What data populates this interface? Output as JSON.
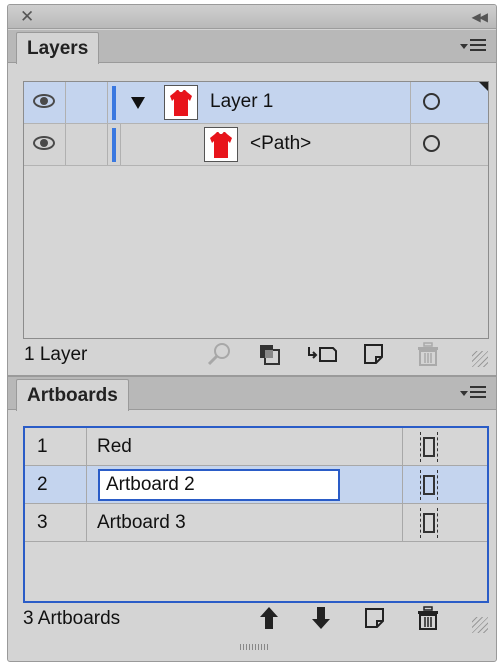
{
  "layers_panel": {
    "tab_label": "Layers",
    "rows": [
      {
        "name": "Layer 1"
      },
      {
        "name": "<Path>"
      }
    ],
    "footer_status": "1 Layer"
  },
  "artboards_panel": {
    "tab_label": "Artboards",
    "rows": [
      {
        "number": "1",
        "name": "Red"
      },
      {
        "number": "2",
        "name": "Artboard 2"
      },
      {
        "number": "3",
        "name": "Artboard 3"
      }
    ],
    "footer_status": "3 Artboards"
  },
  "colors": {
    "selection": "#c4d4ee",
    "accent_blue": "#2a5cc7",
    "layer_color_bar": "#3a78e0",
    "thumbnail_shirt": "#e8141b"
  },
  "icons": [
    "close-icon",
    "collapse-panel-icon",
    "panel-menu-icon",
    "visibility-eye-icon",
    "disclosure-triangle-icon",
    "target-circle-icon",
    "locate-object-icon",
    "clipping-mask-icon",
    "sublayer-icon",
    "new-layer-icon",
    "trash-icon",
    "move-up-icon",
    "move-down-icon",
    "new-artboard-icon",
    "artboard-options-icon"
  ]
}
